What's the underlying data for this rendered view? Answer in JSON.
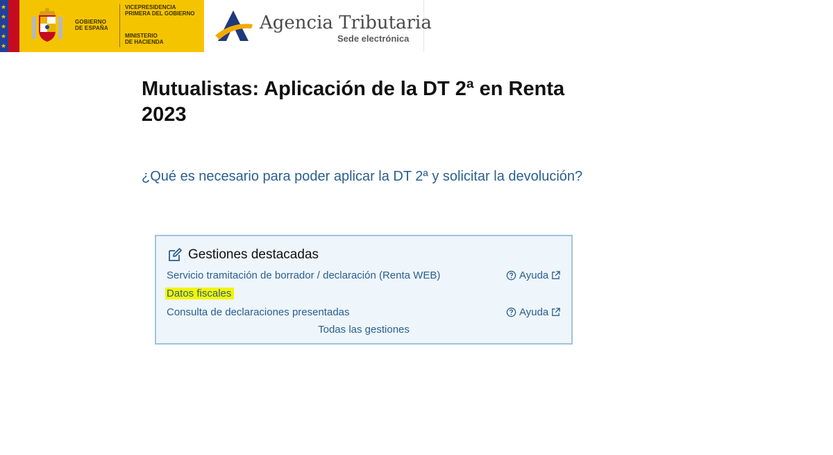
{
  "header": {
    "gov_line1": "GOBIERNO",
    "gov_line2": "DE ESPAÑA",
    "vice_line1": "VICEPRESIDENCIA",
    "vice_line2": "PRIMERA DEL GOBIERNO",
    "min_line1": "MINISTERIO",
    "min_line2": "DE HACIENDA",
    "agency_title": "Agencia Tributaria",
    "agency_subtitle": "Sede electrónica"
  },
  "page": {
    "title": "Mutualistas: Aplicación de la DT 2ª en Renta 2023",
    "question": "¿Qué es necesario para poder aplicar la DT 2ª y solicitar la devolución?"
  },
  "panel": {
    "title": "Gestiones destacadas",
    "items": [
      {
        "label": "Servicio tramitación de borrador / declaración (Renta WEB)",
        "help": "Ayuda"
      },
      {
        "label": "Datos fiscales"
      },
      {
        "label": "Consulta de declaraciones presentadas",
        "help": "Ayuda"
      }
    ],
    "all_label": "Todas las gestiones"
  },
  "colors": {
    "link": "#2a5f8f",
    "highlight": "#f3f500",
    "panel_border": "#9fc3de",
    "panel_bg": "#eef5fb",
    "gov_yellow": "#f5c400"
  }
}
